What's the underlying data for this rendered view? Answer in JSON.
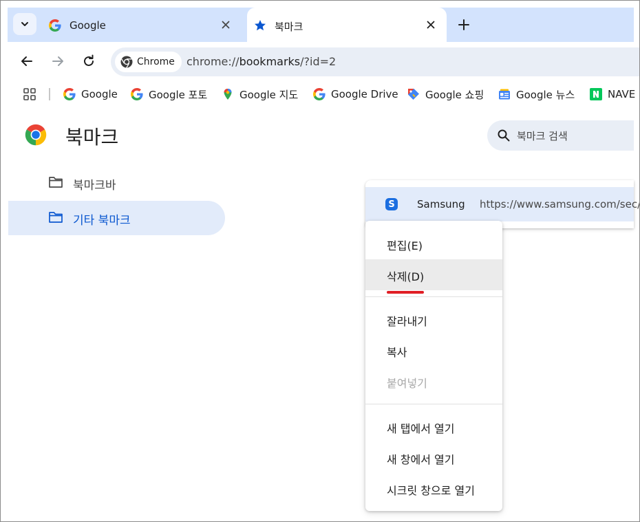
{
  "tabs": [
    {
      "title": "Google",
      "active": false
    },
    {
      "title": "북마크",
      "active": true
    }
  ],
  "omnibox": {
    "chip_label": "Chrome",
    "url_prefix": "chrome://",
    "url_host": "bookmarks",
    "url_path": "/?id=2"
  },
  "bookmarks_bar": [
    {
      "label": "Google",
      "icon": "google-g-icon"
    },
    {
      "label": "Google 포토",
      "icon": "google-g-icon"
    },
    {
      "label": "Google 지도",
      "icon": "google-maps-icon"
    },
    {
      "label": "Google Drive",
      "icon": "google-g-icon"
    },
    {
      "label": "Google 쇼핑",
      "icon": "google-shopping-icon"
    },
    {
      "label": "Google 뉴스",
      "icon": "google-news-icon"
    },
    {
      "label": "NAVE",
      "icon": "naver-icon"
    }
  ],
  "page": {
    "title": "북마크",
    "search_placeholder": "북마크 검색"
  },
  "sidebar": {
    "folders": [
      {
        "label": "북마크바",
        "selected": false
      },
      {
        "label": "기타 북마크",
        "selected": true
      }
    ]
  },
  "bookmark_list": [
    {
      "title": "Samsung",
      "url": "https://www.samsung.com/sec/",
      "icon": "samsung-icon",
      "icon_letter": "S"
    }
  ],
  "context_menu": {
    "groups": [
      [
        {
          "label": "편집(E)",
          "state": "normal"
        },
        {
          "label": "삭제(D)",
          "state": "hover"
        }
      ],
      [
        {
          "label": "잘라내기",
          "state": "normal"
        },
        {
          "label": "복사",
          "state": "normal"
        },
        {
          "label": "붙여넣기",
          "state": "disabled"
        }
      ],
      [
        {
          "label": "새 탭에서 열기",
          "state": "normal"
        },
        {
          "label": "새 창에서 열기",
          "state": "normal"
        },
        {
          "label": "시크릿 창으로 열기",
          "state": "normal"
        }
      ]
    ]
  },
  "colors": {
    "tabstrip": "#d3e3fd",
    "selected_folder_bg": "#e2ebfa",
    "selected_folder_text": "#0b57d0",
    "annotation_underline": "#e01e25"
  }
}
